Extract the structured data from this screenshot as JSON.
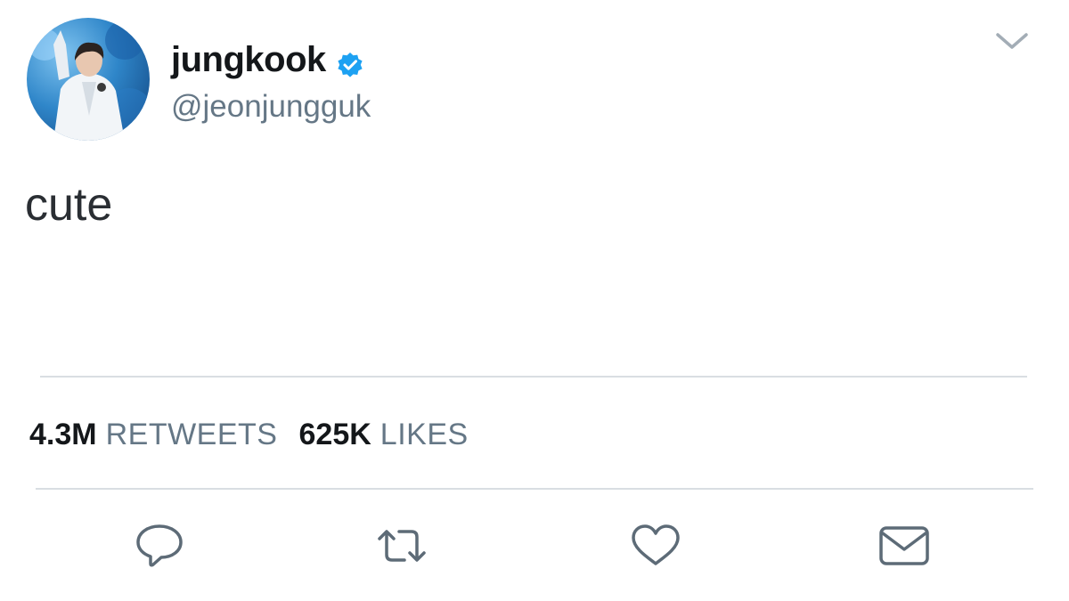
{
  "tweet": {
    "author": {
      "display_name": "jungkook",
      "handle": "@jeonjungguk",
      "verified": true
    },
    "text": "cute",
    "stats": {
      "retweets_count": "4.3M",
      "retweets_label": "RETWEETS",
      "likes_count": "625K",
      "likes_label": "LIKES"
    },
    "actions": [
      {
        "name": "reply",
        "icon": "speech-bubble-icon"
      },
      {
        "name": "retweet",
        "icon": "retweet-arrows-icon"
      },
      {
        "name": "like",
        "icon": "heart-icon"
      },
      {
        "name": "direct-message",
        "icon": "envelope-icon"
      }
    ]
  },
  "colors": {
    "verified": "#1da1f2",
    "icon": "#5d6b77",
    "secondary_text": "#657786",
    "divider": "#d9dee2"
  }
}
